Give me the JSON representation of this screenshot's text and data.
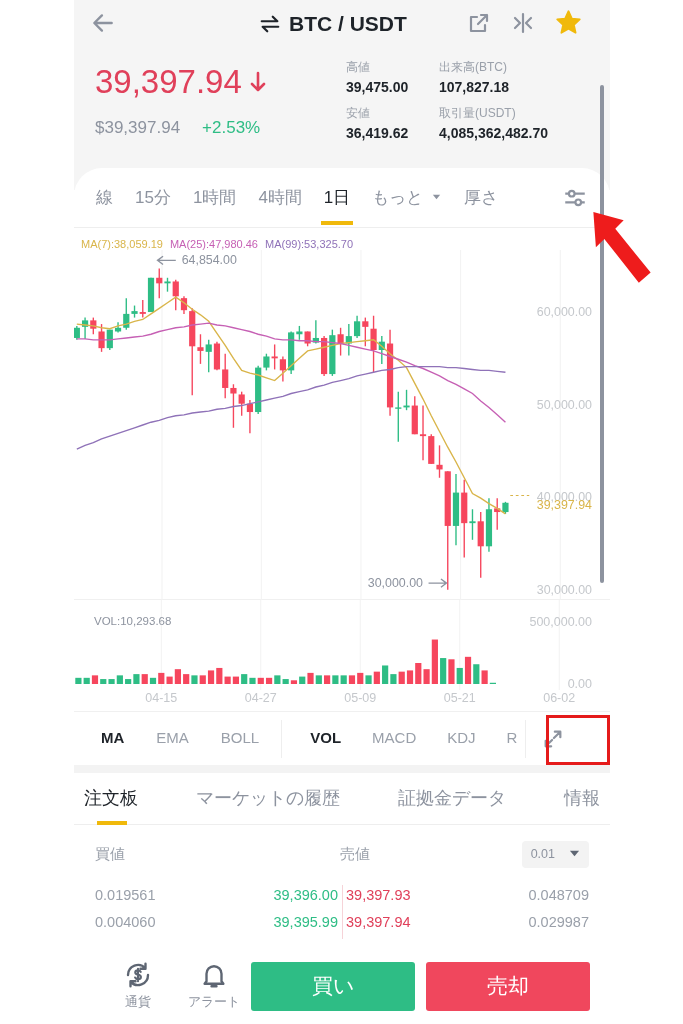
{
  "header": {
    "title": "BTC / USDT",
    "favorite": true
  },
  "price": {
    "last": "39,397.94",
    "usd": "$39,397.94",
    "change": "+2.53%"
  },
  "stats": [
    {
      "label": "高値",
      "value": "39,475.00"
    },
    {
      "label": "出来高(BTC)",
      "value": "107,827.18"
    },
    {
      "label": "安値",
      "value": "36,419.62"
    },
    {
      "label": "取引量(USDT)",
      "value": "4,085,362,482.70"
    }
  ],
  "intervals": [
    {
      "label": "線",
      "selected": false,
      "kind": "tab"
    },
    {
      "label": "15分",
      "selected": false,
      "kind": "tab"
    },
    {
      "label": "1時間",
      "selected": false,
      "kind": "tab"
    },
    {
      "label": "4時間",
      "selected": false,
      "kind": "tab"
    },
    {
      "label": "1日",
      "selected": true,
      "kind": "tab"
    },
    {
      "label": "もっと",
      "selected": false,
      "kind": "dropdown"
    },
    {
      "label": "厚さ",
      "selected": false,
      "kind": "tab"
    }
  ],
  "price_chart": {
    "high_marker": "64,854.00",
    "low_marker": "30,000.00",
    "last_price": "39,397.94",
    "chart_data": {
      "type": "candlestick",
      "grid": true,
      "categories": [
        null,
        null,
        null,
        null,
        null,
        null,
        null,
        null,
        null,
        null,
        null,
        null,
        null,
        null,
        null,
        null,
        null,
        null,
        null,
        null,
        null,
        null,
        null,
        null,
        null,
        null,
        null,
        null,
        null,
        null,
        null,
        null,
        null,
        null,
        null,
        null,
        null,
        null,
        null,
        null,
        null,
        null,
        null,
        null,
        null,
        null,
        null,
        null,
        null,
        null,
        null,
        null,
        null
      ],
      "ohlc": [
        [
          57200,
          58500,
          57000,
          58300
        ],
        [
          58400,
          59400,
          57100,
          59100
        ],
        [
          59100,
          59400,
          57600,
          58200
        ],
        [
          57900,
          58700,
          55700,
          56100
        ],
        [
          56100,
          58100,
          55900,
          58100
        ],
        [
          57900,
          58900,
          57800,
          58300
        ],
        [
          58300,
          61500,
          58100,
          59800
        ],
        [
          59800,
          60700,
          59400,
          60100
        ],
        [
          60000,
          61300,
          59400,
          59800
        ],
        [
          60000,
          63700,
          60000,
          63700
        ],
        [
          63700,
          64700,
          61500,
          63100
        ],
        [
          63100,
          63700,
          62200,
          63300
        ],
        [
          63300,
          63500,
          60200,
          61700
        ],
        [
          61500,
          61700,
          59800,
          60200
        ],
        [
          60100,
          60400,
          51000,
          56300
        ],
        [
          56200,
          57600,
          54400,
          55800
        ],
        [
          55700,
          57000,
          53500,
          56500
        ],
        [
          56600,
          56800,
          53700,
          53800
        ],
        [
          53800,
          55500,
          50700,
          51800
        ],
        [
          51800,
          52200,
          47500,
          51200
        ],
        [
          51100,
          51400,
          48800,
          50100
        ],
        [
          50100,
          50500,
          46900,
          49200
        ],
        [
          49200,
          54200,
          49000,
          54000
        ],
        [
          54000,
          55500,
          53700,
          55200
        ],
        [
          55200,
          56500,
          53800,
          55000
        ],
        [
          54900,
          55200,
          52500,
          53700
        ],
        [
          53700,
          57900,
          53300,
          57800
        ],
        [
          57600,
          58500,
          57000,
          57900
        ],
        [
          57900,
          57900,
          56300,
          56600
        ],
        [
          56700,
          59100,
          56600,
          57200
        ],
        [
          57200,
          57400,
          53100,
          53300
        ],
        [
          53300,
          58100,
          53100,
          57500
        ],
        [
          57600,
          58300,
          55300,
          56600
        ],
        [
          56600,
          58700,
          55300,
          57400
        ],
        [
          57400,
          59600,
          57200,
          59000
        ],
        [
          59000,
          59400,
          56300,
          58400
        ],
        [
          58200,
          59600,
          53500,
          55900
        ],
        [
          55900,
          57400,
          54400,
          56800
        ],
        [
          56600,
          58100,
          48800,
          49700
        ],
        [
          49600,
          51400,
          46000,
          49700
        ],
        [
          49700,
          51600,
          49400,
          49900
        ],
        [
          49900,
          50900,
          46800,
          46800
        ],
        [
          46800,
          49900,
          44000,
          46600
        ],
        [
          46600,
          46800,
          43600,
          43600
        ],
        [
          43500,
          45600,
          42100,
          43000
        ],
        [
          42800,
          42800,
          30000,
          36900
        ],
        [
          36900,
          42500,
          34800,
          40500
        ],
        [
          40500,
          41900,
          33500,
          37200
        ],
        [
          37200,
          38700,
          35400,
          37400
        ],
        [
          37400,
          38400,
          31300,
          34700
        ],
        [
          34700,
          39900,
          34100,
          38700
        ],
        [
          38800,
          39900,
          36500,
          38400
        ],
        [
          38400,
          39500,
          38200,
          39400
        ]
      ],
      "series": [
        {
          "name": "MA(7):38,059.19",
          "type": "line",
          "color": "#d9b54a",
          "values": [
            58700,
            58600,
            58500,
            58300,
            58200,
            58500,
            58700,
            59000,
            59200,
            59800,
            60400,
            61000,
            61600,
            61000,
            60300,
            59700,
            59000,
            57700,
            56400,
            55000,
            53700,
            53400,
            53200,
            52900,
            52600,
            53400,
            54200,
            55000,
            55800,
            56000,
            56200,
            56400,
            56600,
            56700,
            56800,
            56900,
            57000,
            56300,
            55500,
            54800,
            54000,
            52300,
            50600,
            48800,
            47100,
            45400,
            43800,
            42100,
            40400,
            39900,
            39300,
            38800,
            38200
          ]
        },
        {
          "name": "MA(25):47,980.46",
          "type": "line",
          "color": "#c660b4",
          "values": [
            57100,
            57100,
            57000,
            57000,
            57000,
            57100,
            57200,
            57300,
            57400,
            57600,
            57900,
            58100,
            58300,
            58400,
            58600,
            58700,
            58800,
            58600,
            58500,
            58300,
            58100,
            57900,
            57600,
            57400,
            57100,
            57000,
            57000,
            56900,
            56900,
            56800,
            56800,
            56700,
            56600,
            56400,
            56200,
            56000,
            55800,
            55500,
            55200,
            54900,
            54600,
            54200,
            53900,
            53500,
            53100,
            52600,
            52200,
            51700,
            51200,
            50400,
            49700,
            48900,
            48100
          ]
        },
        {
          "name": "MA(99):53,325.70",
          "type": "line",
          "color": "#8f72b8",
          "values": [
            45200,
            45600,
            45900,
            46300,
            46600,
            46900,
            47200,
            47500,
            47800,
            48100,
            48300,
            48600,
            48800,
            48900,
            49100,
            49200,
            49300,
            49500,
            49600,
            49800,
            49900,
            50100,
            50300,
            50500,
            50700,
            50900,
            51200,
            51400,
            51600,
            51900,
            52100,
            52400,
            52600,
            52800,
            53100,
            53300,
            53500,
            53700,
            53800,
            54000,
            54100,
            54100,
            54100,
            54100,
            54100,
            54000,
            54000,
            53900,
            53800,
            53700,
            53700,
            53600,
            53500
          ]
        }
      ],
      "ylim": [
        28900,
        66700
      ],
      "yticks": [
        {
          "value": 60000,
          "label": "60,000.00"
        },
        {
          "value": 50000,
          "label": "50,000.00"
        },
        {
          "value": 40000,
          "label": "40,000.00"
        },
        {
          "value": 30000,
          "label": "30,000.00"
        }
      ]
    }
  },
  "volume": {
    "label": "VOL:10,293.68",
    "chart_data": {
      "type": "bar",
      "stacked": true,
      "grid": true,
      "categories": [
        null,
        null,
        null,
        null,
        null,
        null,
        null,
        null,
        null,
        null,
        "04-15",
        null,
        null,
        null,
        null,
        null,
        null,
        null,
        null,
        null,
        null,
        null,
        "04-27",
        null,
        null,
        null,
        null,
        null,
        null,
        null,
        null,
        null,
        null,
        null,
        "05-09",
        null,
        null,
        null,
        null,
        null,
        null,
        null,
        null,
        null,
        null,
        null,
        "05-21",
        null,
        null,
        null,
        null,
        null,
        null,
        null,
        null,
        null,
        null,
        null,
        "06-02"
      ],
      "series": [
        {
          "color": "#2ebd85",
          "values": [
            50000,
            50000,
            null,
            40000,
            40000,
            70000,
            40000,
            80000,
            null,
            50000,
            null,
            null,
            null,
            null,
            70000,
            null,
            null,
            null,
            null,
            null,
            80000,
            50000,
            null,
            null,
            70000,
            40000,
            null,
            60000,
            null,
            70000,
            null,
            70000,
            70000,
            null,
            null,
            70000,
            null,
            150000,
            80000,
            null,
            null,
            null,
            null,
            null,
            210000,
            null,
            130000,
            null,
            160000,
            null,
            10000,
            null,
            null,
            null,
            null,
            null,
            null,
            null,
            null
          ]
        },
        {
          "color": "#f6465d",
          "values": [
            null,
            null,
            70000,
            null,
            null,
            null,
            null,
            null,
            80000,
            null,
            90000,
            60000,
            120000,
            80000,
            null,
            70000,
            110000,
            130000,
            60000,
            60000,
            null,
            null,
            50000,
            50000,
            null,
            null,
            30000,
            null,
            90000,
            null,
            70000,
            null,
            null,
            70000,
            90000,
            null,
            100000,
            null,
            null,
            100000,
            110000,
            170000,
            120000,
            360000,
            null,
            200000,
            null,
            220000,
            null,
            110000,
            null,
            null,
            null,
            null,
            null,
            null,
            null,
            null,
            null
          ]
        }
      ],
      "ylim": [
        0,
        680000
      ],
      "yticks": [
        {
          "value": 0,
          "label": "0.00"
        },
        {
          "value": 500000,
          "label": "500,000.00"
        }
      ]
    }
  },
  "indicators": {
    "main": [
      {
        "label": "MA",
        "selected": true
      },
      {
        "label": "EMA",
        "selected": false
      },
      {
        "label": "BOLL",
        "selected": false
      }
    ],
    "sub": [
      {
        "label": "VOL",
        "selected": true
      },
      {
        "label": "MACD",
        "selected": false
      },
      {
        "label": "KDJ",
        "selected": false
      },
      {
        "label": "R",
        "selected": false
      }
    ]
  },
  "book_tabs": [
    {
      "label": "注文板",
      "selected": true
    },
    {
      "label": "マーケットの履歴",
      "selected": false
    },
    {
      "label": "証拠金データ",
      "selected": false
    },
    {
      "label": "情報",
      "selected": false
    }
  ],
  "order_book": {
    "bid_header": "買値",
    "ask_header": "売値",
    "precision": "0.01",
    "rows": [
      {
        "bid_qty": "0.019561",
        "bid_price": "39,396.00",
        "ask_price": "39,397.93",
        "ask_qty": "0.048709"
      },
      {
        "bid_qty": "0.004060",
        "bid_price": "39,395.99",
        "ask_price": "39,397.94",
        "ask_qty": "0.029987"
      }
    ]
  },
  "actions": [
    {
      "label": "通貨",
      "kind": "currency"
    },
    {
      "label": "アラート",
      "kind": "alert"
    }
  ],
  "trade_buttons": [
    {
      "label": "買い",
      "kind": "buy"
    },
    {
      "label": "売却",
      "kind": "sell"
    }
  ]
}
